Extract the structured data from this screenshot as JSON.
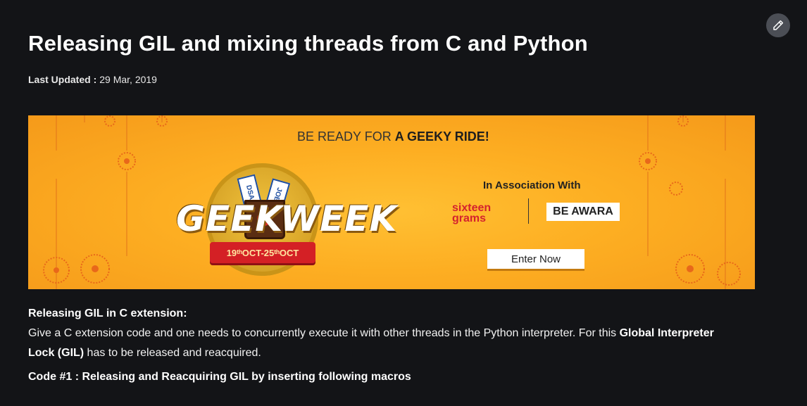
{
  "header": {
    "title": "Releasing GIL and mixing threads from C and Python",
    "last_updated_label": "Last Updated :",
    "last_updated_date": "29 Mar, 2019",
    "edit_icon": "pencil-icon"
  },
  "banner": {
    "tagline_normal": "BE READY FOR",
    "tagline_bold": "A GEEKY RIDE!",
    "logo_left": "GEEK",
    "logo_right": "WEEK",
    "ticket_1": "DSA",
    "ticket_2": "JOBS",
    "ribbon": "19ᵗʰOCT-25ᵗʰOCT",
    "association_label": "In Association With",
    "partner_1_line1": "sixteen",
    "partner_1_line2": "grams",
    "partner_2": "BE AWARA",
    "cta": "Enter Now",
    "colors": {
      "background": "#fdae22",
      "ribbon": "#d42025",
      "partner_1": "#d4222e"
    }
  },
  "article": {
    "section_heading": "Releasing GIL in C extension:",
    "para_1_start": "Give a C extension code and one needs to concurrently execute it with other threads in the Python interpreter. For this ",
    "para_1_bold": "Global Interpreter Lock (GIL)",
    "para_1_end": " has to be released and reacquired.",
    "code_heading": "Code #1 : Releasing and Reacquiring GIL by inserting following macros"
  }
}
